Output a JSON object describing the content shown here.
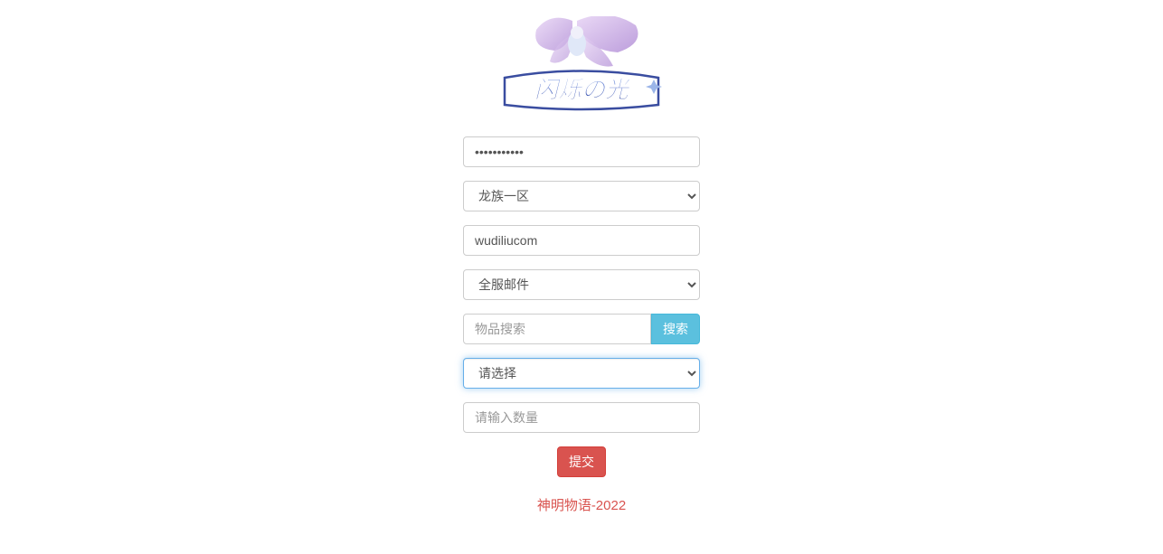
{
  "logo": {
    "alt": "闪烁の光"
  },
  "form": {
    "password": {
      "value": "•••••••••••"
    },
    "server": {
      "selected": "龙族一区"
    },
    "username": {
      "value": "wudiliucom"
    },
    "mailType": {
      "selected": "全服邮件"
    },
    "itemSearch": {
      "placeholder": "物品搜索",
      "value": ""
    },
    "searchButton": "搜索",
    "itemSelect": {
      "selected": "请选择"
    },
    "quantity": {
      "placeholder": "请输入数量",
      "value": ""
    },
    "submitButton": "提交"
  },
  "footer": "神明物语-2022"
}
